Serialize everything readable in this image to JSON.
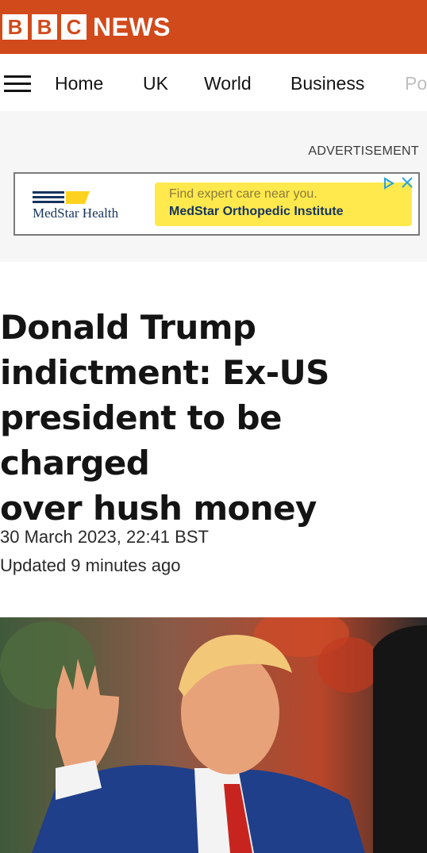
{
  "masthead": {
    "letters": [
      "B",
      "B",
      "C"
    ],
    "wordmark": "NEWS"
  },
  "nav": {
    "items": [
      "Home",
      "UK",
      "World",
      "Business",
      "Po"
    ]
  },
  "ad": {
    "label": "ADVERTISEMENT",
    "brand": "MedStar Health",
    "line1": "Find expert care near you.",
    "line2": "MedStar Orthopedic Institute"
  },
  "article": {
    "headline": "Donald Trump\nindictment: Ex-US\npresident to be charged\nover hush money",
    "date": "30 March 2023, 22:41 BST",
    "updated": "Updated 9 minutes ago"
  },
  "colors": {
    "brand_red": "#d14a1c",
    "ad_yellow": "#ffe94d",
    "ad_navy": "#16335f"
  },
  "icons": {
    "menu": "hamburger-icon",
    "ad_choices": "ad-choices-icon",
    "ad_close": "close-icon"
  }
}
